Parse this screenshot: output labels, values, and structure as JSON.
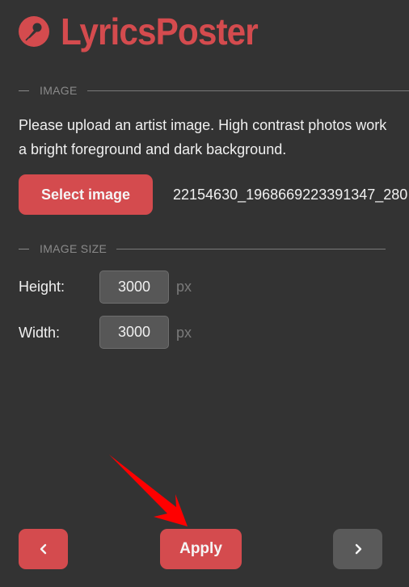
{
  "app": {
    "title": "LyricsPoster",
    "logo_icon": "microphone-icon"
  },
  "image_section": {
    "heading": "IMAGE",
    "description_line1": "Please upload an artist image. High contrast photos work",
    "description_line2": "a bright foreground and dark background.",
    "select_button_label": "Select image",
    "selected_filename": "22154630_1968669223391347_280"
  },
  "size_section": {
    "heading": "IMAGE SIZE",
    "height_label": "Height:",
    "height_value": "3000",
    "height_unit": "px",
    "width_label": "Width:",
    "width_value": "3000",
    "width_unit": "px"
  },
  "footer": {
    "prev_icon": "chevron-left-icon",
    "apply_label": "Apply",
    "next_icon": "chevron-right-icon"
  },
  "annotation": {
    "arrow_color": "#ff0000",
    "points_to": "Apply"
  },
  "colors": {
    "background": "#333333",
    "accent": "#d44b4e",
    "disabled_button": "#5a5a5a"
  }
}
